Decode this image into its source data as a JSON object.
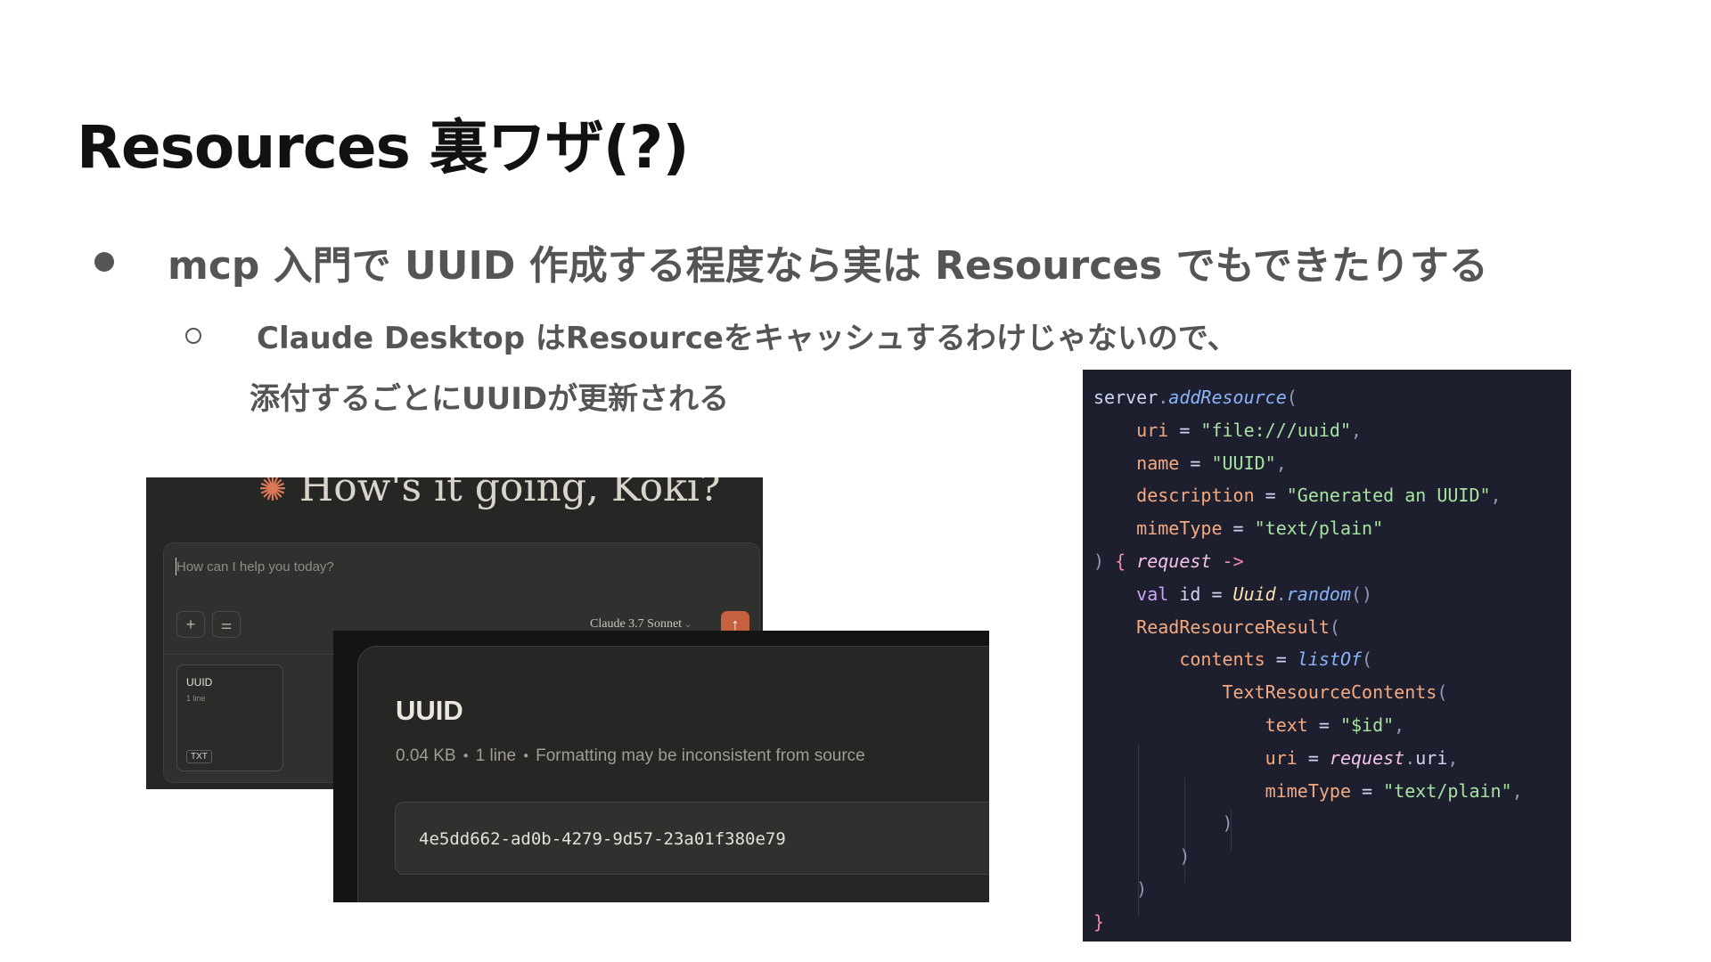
{
  "slide": {
    "title": "Resources 裏ワザ(?)",
    "bullet1": "mcp 入門で UUID 作成する程度なら実は Resources でもできたりする",
    "bullet2_line1": "Claude Desktop はResourceをキャッシュするわけじゃないので、",
    "bullet2_line2": "添付するごとにUUIDが更新される"
  },
  "chat": {
    "greeting": "How's it going, Koki?",
    "greeting_icon": "claude-spark-icon",
    "input_placeholder": "How can I help you today?",
    "plus_label": "+",
    "sliders_label": "⚌",
    "model_label": "Claude 3.7 Sonnet",
    "send_label": "↑",
    "attachment": {
      "name": "UUID",
      "meta": "1 line",
      "tag": "TXT"
    }
  },
  "preview": {
    "title": "UUID",
    "size": "0.04 KB",
    "lines": "1 line",
    "note": "Formatting may be inconsistent from source",
    "value": "4e5dd662-ad0b-4279-9d57-23a01f380e79"
  },
  "code": {
    "language": "kotlin",
    "lines": [
      "server.addResource(",
      "    uri = \"file:///uuid\",",
      "    name = \"UUID\",",
      "    description = \"Generated an UUID\",",
      "    mimeType = \"text/plain\"",
      ") { request ->",
      "    val id = Uuid.random()",
      "    ReadResourceResult(",
      "        contents = listOf(",
      "            TextResourceContents(",
      "                text = \"$id\",",
      "                uri = request.uri,",
      "                mimeType = \"text/plain\",",
      "            )",
      "        )",
      "    )",
      "}"
    ]
  },
  "colors": {
    "accent": "#c6613f",
    "editor_bg": "#1e1f2e",
    "chat_bg": "#262624"
  }
}
